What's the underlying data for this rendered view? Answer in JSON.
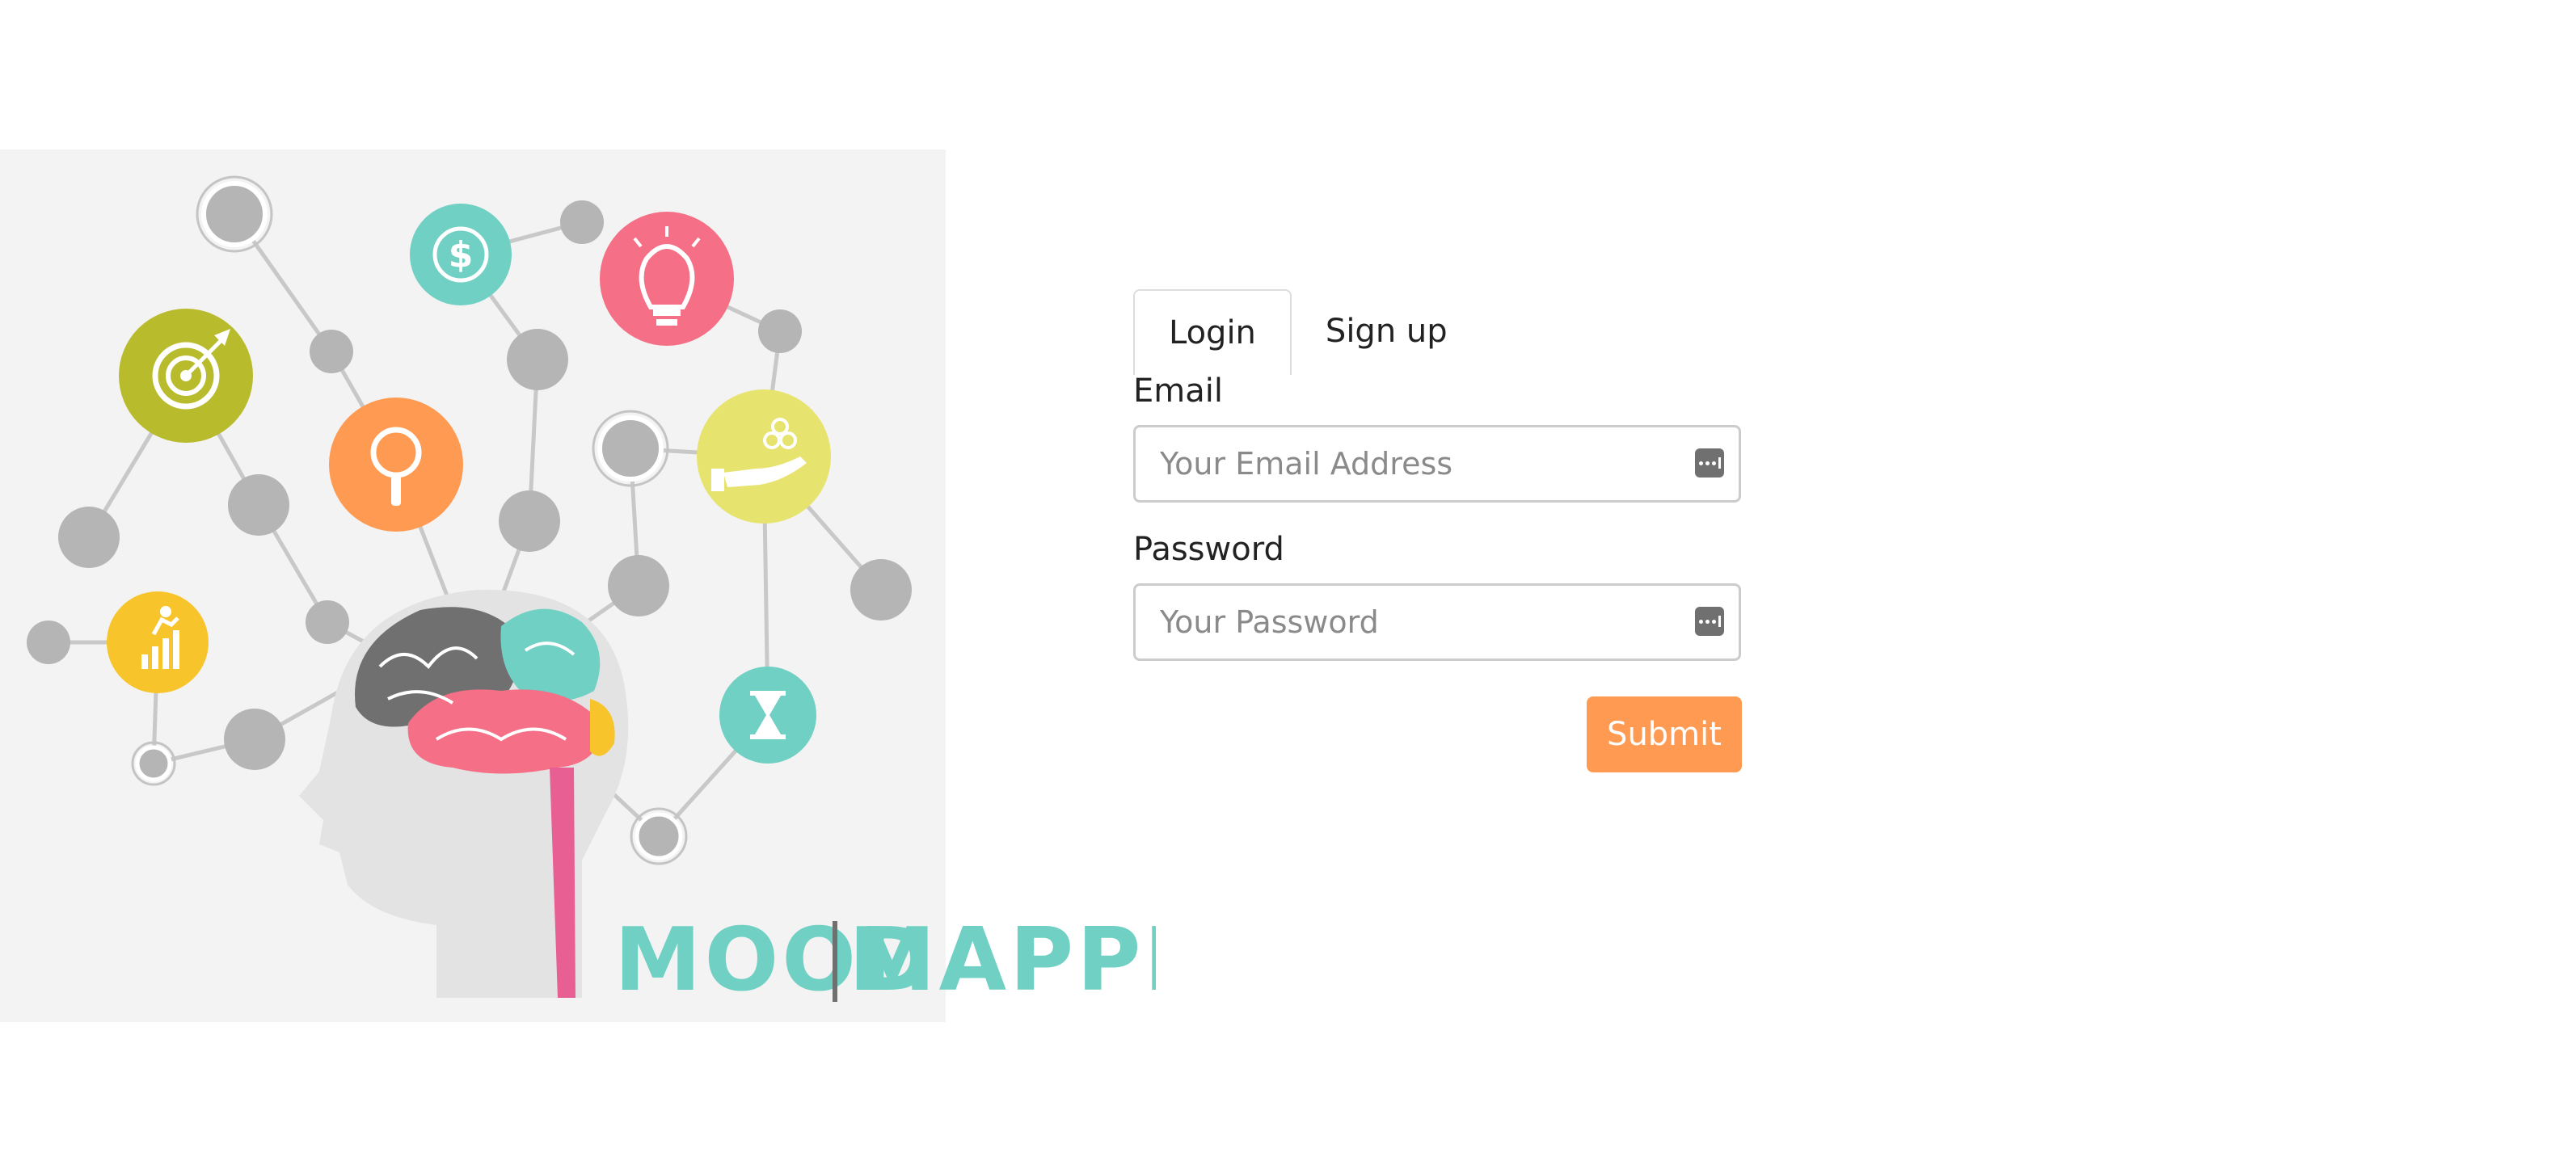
{
  "brand": {
    "word_left": "MOOD",
    "word_right": "MAPPER",
    "color_teal": "#6fd0c3",
    "color_pink": "#f56f86",
    "color_orange": "#ff9a52",
    "color_olive": "#b7bb2c",
    "color_yellow": "#f7c52b",
    "color_lightyellow": "#e7e36f",
    "color_node": "#b5b5b5"
  },
  "tabs": {
    "login": "Login",
    "signup": "Sign up"
  },
  "form": {
    "email_label": "Email",
    "email_placeholder": "Your Email Address",
    "password_label": "Password",
    "password_placeholder": "Your Password",
    "submit_label": "Submit"
  },
  "icons": {
    "hero": [
      "target-icon",
      "dollar-icon",
      "lightbulb-icon",
      "magnifier-icon",
      "hand-coins-icon",
      "runner-chart-icon",
      "hourglass-icon",
      "brain-icon"
    ],
    "input": "password-manager-icon"
  }
}
